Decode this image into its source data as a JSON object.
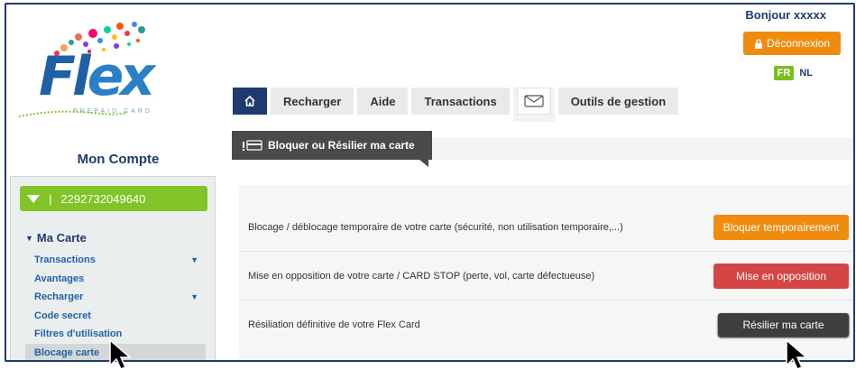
{
  "header": {
    "logo_text_f": "Fl",
    "logo_text_ex": "ex",
    "logo_sub": "PREPAID CARD",
    "greeting": "Bonjour xxxxx",
    "logout_label": "Déconnexion",
    "lang_fr": "FR",
    "lang_nl": "NL"
  },
  "tabs": {
    "recharger": "Recharger",
    "aide": "Aide",
    "transactions": "Transactions",
    "outils": "Outils de gestion"
  },
  "subtab": {
    "label": "Bloquer ou Résilier ma carte"
  },
  "sidebar": {
    "title": "Mon Compte",
    "card_number": "2292732049640",
    "section": "Ma Carte",
    "items": [
      {
        "label": "Transactions",
        "has_chevron": true
      },
      {
        "label": "Avantages",
        "has_chevron": false
      },
      {
        "label": "Recharger",
        "has_chevron": true
      },
      {
        "label": "Code secret",
        "has_chevron": false
      },
      {
        "label": "Filtres d'utilisation",
        "has_chevron": false
      },
      {
        "label": "Blocage carte",
        "has_chevron": false
      }
    ]
  },
  "rows": [
    {
      "text": "Blocage / déblocage temporaire de votre carte (sécurité, non utilisation temporaire,...)",
      "button": "Bloquer temporairement"
    },
    {
      "text": "Mise en opposition de votre carte / CARD STOP (perte, vol, carte défectueuse)",
      "button": "Mise en opposition"
    },
    {
      "text": "Résiliation définitive de votre Flex Card",
      "button": "Résilier ma carte"
    }
  ],
  "colors": {
    "navy": "#1f3a6e",
    "orange": "#ef8c0f",
    "red": "#d64545",
    "green": "#82c427",
    "dark": "#3e3e3e"
  }
}
